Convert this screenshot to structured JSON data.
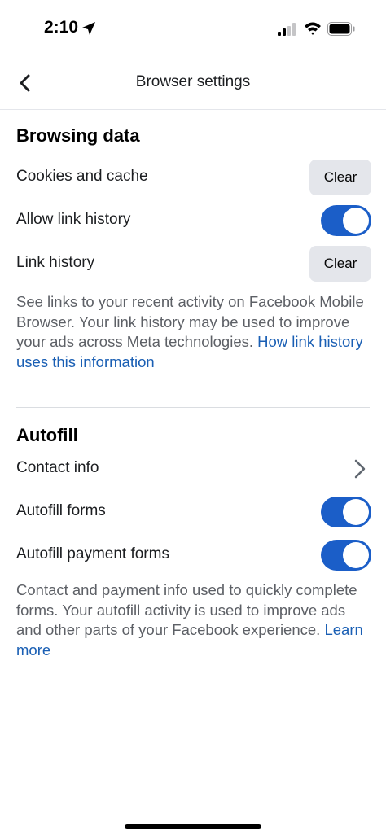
{
  "status_bar": {
    "time": "2:10"
  },
  "nav": {
    "title": "Browser settings"
  },
  "browsing_data": {
    "title": "Browsing data",
    "rows": [
      {
        "label": "Cookies and cache",
        "button": "Clear"
      },
      {
        "label": "Allow link history",
        "toggle_on": true
      },
      {
        "label": "Link history",
        "button": "Clear"
      }
    ],
    "description": "See links to your recent activity on Facebook Mobile Browser. Your link history may be used to improve your ads across Meta technologies.",
    "link": "How link history uses this information"
  },
  "autofill": {
    "title": "Autofill",
    "rows": [
      {
        "label": "Contact info"
      },
      {
        "label": "Autofill forms",
        "toggle_on": true
      },
      {
        "label": "Autofill payment forms",
        "toggle_on": true
      }
    ],
    "description": "Contact and payment info used to quickly complete forms. Your autofill activity is used to improve ads and other parts of your Facebook experience.",
    "link": "Learn more"
  },
  "colors": {
    "accent": "#1b5ec8",
    "link": "#1a5fb4",
    "button_bg": "#e4e6eb"
  }
}
